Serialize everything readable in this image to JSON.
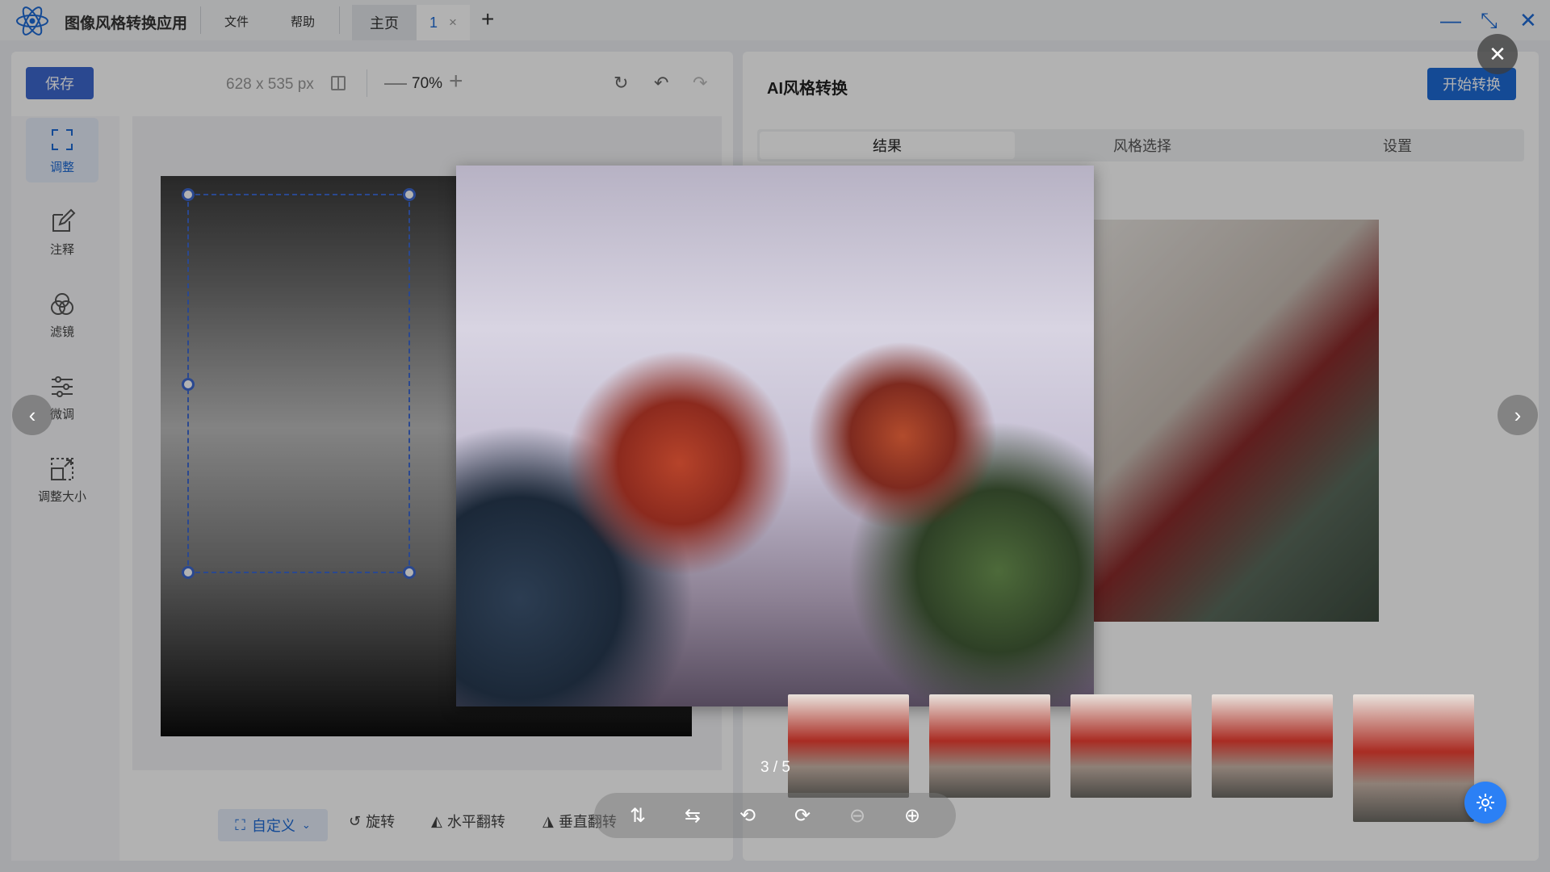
{
  "app": {
    "title": "图像风格转换应用",
    "menus": [
      "文件",
      "帮助"
    ],
    "tabs": [
      {
        "label": "主页"
      },
      {
        "label": "1",
        "close": "×"
      }
    ],
    "add_tab": "+",
    "window_controls": {
      "minimize": "—",
      "restore": "⤡",
      "close": "✕"
    }
  },
  "editor": {
    "save_label": "保存",
    "image_size": "628 x 535 px",
    "zoom_minus": "—",
    "zoom_value": "70%",
    "zoom_plus": "+",
    "tools": [
      {
        "label": "调整",
        "icon": "crop-icon",
        "active": true
      },
      {
        "label": "注释",
        "icon": "edit-icon",
        "active": false
      },
      {
        "label": "滤镜",
        "icon": "filter-icon",
        "active": false
      },
      {
        "label": "微调",
        "icon": "sliders-icon",
        "active": false
      },
      {
        "label": "调整大小",
        "icon": "resize-icon",
        "active": false
      }
    ],
    "bottom_actions": {
      "custom": "自定义",
      "rotate": "旋转",
      "flip_h": "水平翻转",
      "flip_v": "垂直翻转"
    }
  },
  "ai_panel": {
    "title": "AI风格转换",
    "start_label": "开始转换",
    "tabs": [
      {
        "label": "结果",
        "active": true
      },
      {
        "label": "风格选择",
        "active": false
      },
      {
        "label": "设置",
        "active": false
      }
    ]
  },
  "viewer": {
    "close": "✕",
    "prev": "‹",
    "next": "›",
    "counter": "3 / 5",
    "toolbar_icons": [
      "flip-vertical-icon",
      "flip-horizontal-icon",
      "rotate-left-icon",
      "rotate-right-icon",
      "zoom-out-icon",
      "zoom-in-icon"
    ]
  },
  "colors": {
    "accent": "#1e6bd6",
    "save": "#3d67cf",
    "fab": "#2b80f5"
  }
}
